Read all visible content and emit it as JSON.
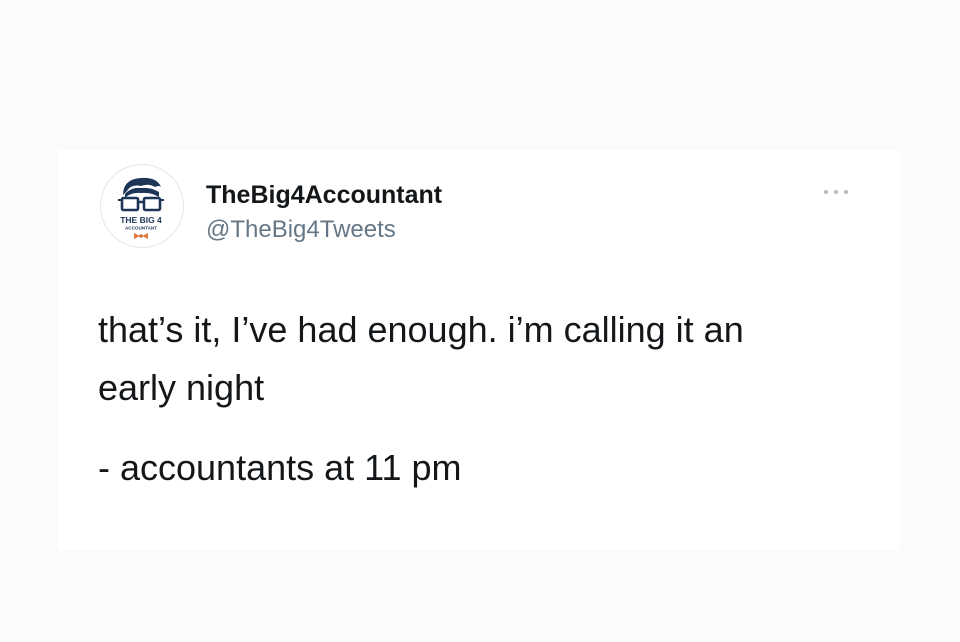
{
  "tweet": {
    "author": {
      "display_name": "TheBig4Accountant",
      "handle": "@TheBig4Tweets",
      "avatar_text_line1": "THE BIG 4",
      "avatar_text_line2": "ACCOUNTANT"
    },
    "text_lines": [
      "that’s it, I’ve had enough. i’m calling it an",
      "early night",
      "- accountants at 11 pm"
    ],
    "more_icon": "more-horizontal-icon"
  },
  "colors": {
    "text_primary": "#14171a",
    "text_secondary": "#657786",
    "avatar_navy": "#1d3557",
    "avatar_bowtie": "#e07a3f"
  }
}
